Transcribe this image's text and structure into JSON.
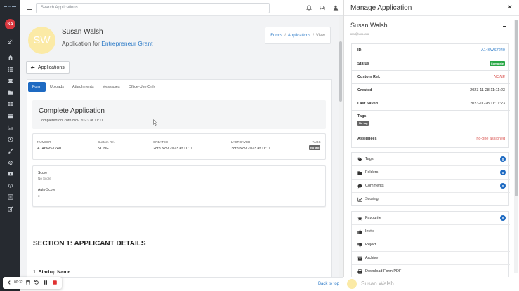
{
  "sidebar": {
    "avatar_initials": "SA",
    "brand_color": "#262a30",
    "avatar_color": "#d9363e",
    "icons": [
      "link-icon",
      "home-icon",
      "list-icon",
      "users-icon",
      "folder-icon",
      "table-icon",
      "calendar-icon",
      "chart-icon",
      "user-circle-icon",
      "brush-icon",
      "settings-icon",
      "video-icon",
      "code-icon",
      "list-alt-icon",
      "edit-icon"
    ]
  },
  "topbar": {
    "search_placeholder": "Search Applications..."
  },
  "profile": {
    "initials": "SW",
    "name": "Susan Walsh",
    "subtitle_prefix": "Application for",
    "grant": "Entrepreneur Grant"
  },
  "breadcrumb": {
    "items": [
      "Forms",
      "Applications",
      "View"
    ]
  },
  "back_button": "Applications",
  "tabs": [
    "Form",
    "Uploads",
    "Attachments",
    "Messages",
    "Office-Use Only"
  ],
  "status_card": {
    "title": "Complete Application",
    "subtitle": "Completed on 28th Nov 2023 at 11:11"
  },
  "info": {
    "number_label": "NUMBER",
    "number": "A146WS7240",
    "custom_label": "Custom Ref.",
    "custom": "NONE",
    "created_label": "CREATED",
    "created": "28th Nov 2023 at 11:11",
    "saved_label": "LAST SAVED",
    "saved": "28th Nov 2023 at 11:11",
    "tags_label": "TAGS",
    "tag": "No tag"
  },
  "score": {
    "score_label": "Score",
    "score_value": "No Score",
    "auto_label": "Auto-Score",
    "auto_value": "3"
  },
  "section_title": "SECTION 1: APPLICANT DETAILS",
  "question": {
    "number": "1.",
    "text": "Startup Name"
  },
  "panel": {
    "title": "Manage Application",
    "name": "Susan Walsh",
    "email": "xxx@xxx.xxx",
    "details": {
      "id_label": "ID.",
      "id": "A146WS7240",
      "status_label": "Status",
      "status": "Complete",
      "custom_label": "Custom Ref.",
      "custom": "NONE",
      "created_label": "Created",
      "created": "2023-11-28 11:11:23",
      "saved_label": "Last Saved",
      "saved": "2023-11-28 11:11:23",
      "tags_label": "Tags",
      "tag": "No tag",
      "assignees_label": "Assignees",
      "assignees": "no-one assigned"
    },
    "group1": [
      {
        "label": "Tags",
        "count": "0",
        "icon": "tag-icon"
      },
      {
        "label": "Folders",
        "count": "0",
        "icon": "folder-icon"
      },
      {
        "label": "Comments",
        "count": "0",
        "icon": "comment-icon"
      },
      {
        "label": "Scoring",
        "icon": "scoring-icon"
      }
    ],
    "group2": [
      {
        "label": "Favourite",
        "count": "0",
        "icon": "star-icon"
      },
      {
        "label": "Invite",
        "icon": "thumbs-up-icon"
      },
      {
        "label": "Reject",
        "icon": "thumbs-down-icon"
      },
      {
        "label": "Archive",
        "icon": "archive-icon"
      },
      {
        "label": "Download Form PDF",
        "icon": "print-icon"
      }
    ]
  },
  "footer": {
    "back_to_top": "Back to top",
    "name": "Susan Walsh"
  },
  "recorder": {
    "time": "00:32"
  }
}
